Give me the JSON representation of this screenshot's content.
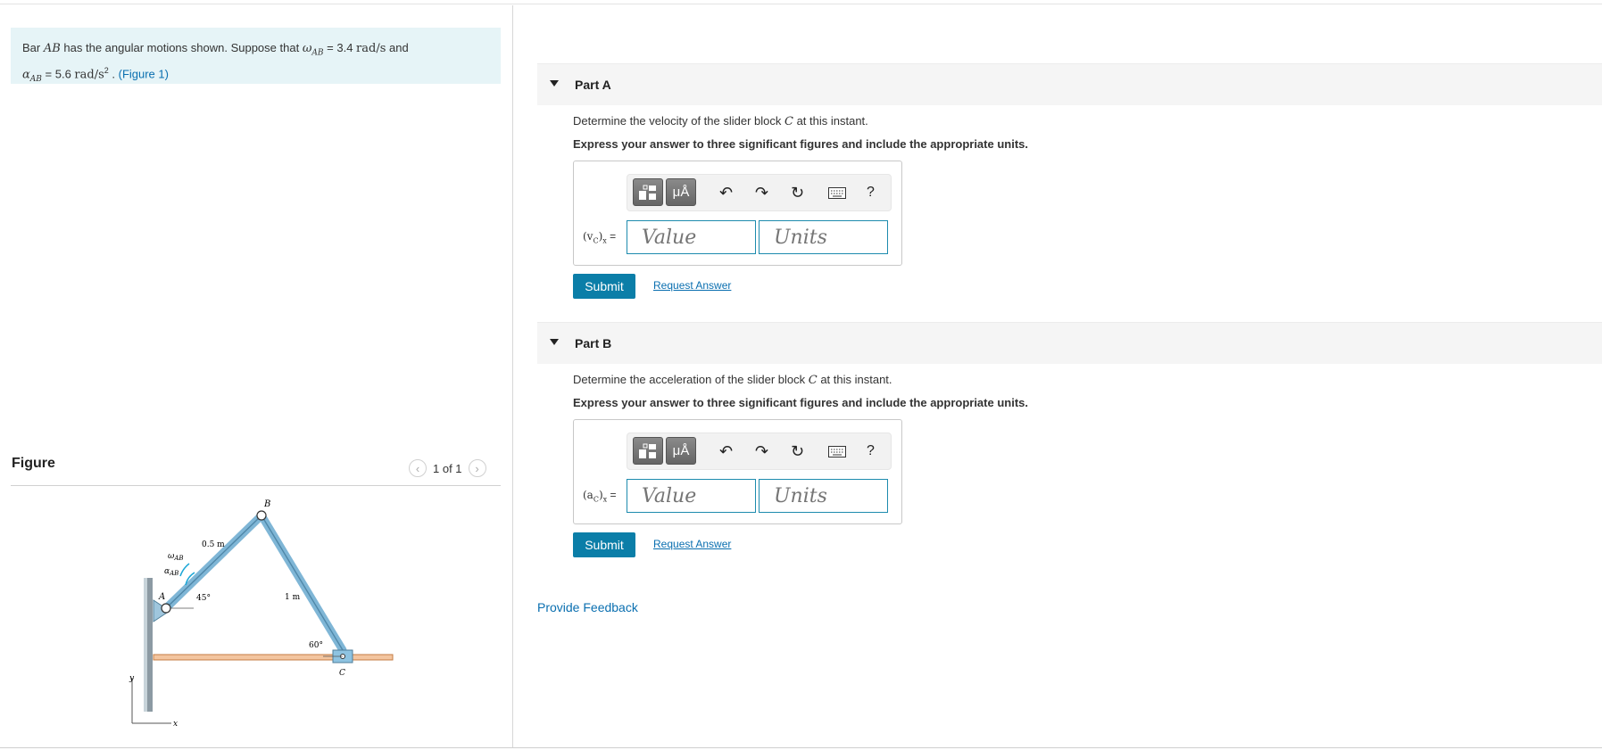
{
  "problem": {
    "text_pre": "Bar ",
    "bar_name": "AB",
    "text_mid": " has the angular motions shown. Suppose that ",
    "omega_symbol": "ω",
    "omega_sub": "AB",
    "omega_eq": " = 3.4 ",
    "omega_unit": "rad/s",
    "text_and": " and",
    "alpha_symbol": "α",
    "alpha_sub": "AB",
    "alpha_eq": " = 5.6 ",
    "alpha_unit": "rad/s",
    "alpha_unit_sup": "2",
    "dot": " . ",
    "figure_link": "(Figure 1)"
  },
  "figure": {
    "title": "Figure",
    "pager": "1 of 1",
    "labels": {
      "B": "B",
      "A": "A",
      "C": "C",
      "len_ab": "0.5 m",
      "len_bc": "1 m",
      "angle_a": "45°",
      "angle_c": "60°",
      "omega": "ω",
      "omega_sub": "AB",
      "alpha": "α",
      "alpha_sub": "AB",
      "y": "y",
      "x": "x"
    }
  },
  "parts": [
    {
      "title": "Part A",
      "prompt_pre": "Determine the velocity of the slider block ",
      "prompt_var": "C",
      "prompt_post": " at this instant.",
      "instruction": "Express your answer to three significant figures and include the appropriate units.",
      "label_main": "(v",
      "label_sub": "C",
      "label_end": ")",
      "label_x": "x",
      "label_eq": " =",
      "value_placeholder": "Value",
      "units_placeholder": "Units",
      "submit": "Submit",
      "request": "Request Answer"
    },
    {
      "title": "Part B",
      "prompt_pre": "Determine the acceleration of the slider block ",
      "prompt_var": "C",
      "prompt_post": " at this instant.",
      "instruction": "Express your answer to three significant figures and include the appropriate units.",
      "label_main": "(a",
      "label_sub": "C",
      "label_end": ")",
      "label_x": "x",
      "label_eq": " =",
      "value_placeholder": "Value",
      "units_placeholder": "Units",
      "submit": "Submit",
      "request": "Request Answer"
    }
  ],
  "toolbar": {
    "templates_icon": "templates-icon",
    "units_label": "μÅ",
    "undo": "↶",
    "redo": "↷",
    "reset": "↻",
    "keyboard_icon": "keyboard-icon",
    "help": "?"
  },
  "feedback": "Provide Feedback",
  "colors": {
    "problem_bg": "#e6f4f7",
    "link": "#0a6fb0",
    "submit_bg": "#0b7ea8",
    "input_border": "#1d8bae"
  }
}
